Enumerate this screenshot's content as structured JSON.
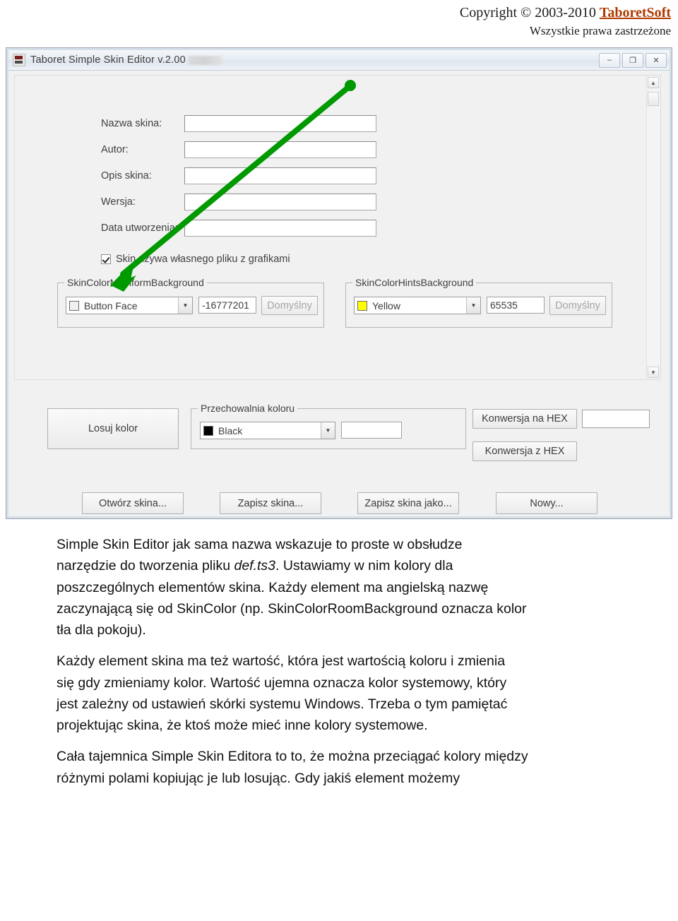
{
  "header": {
    "copyright_prefix": "Copyright © 2003-2010 ",
    "brand": "TaboretSoft",
    "rights": "Wszystkie prawa zastrzeżone"
  },
  "window": {
    "title": "Taboret Simple Skin Editor v.2.00",
    "buttons": {
      "minimize": "–",
      "maximize": "❐",
      "close": "✕"
    },
    "scrollbar": {
      "up": "▲",
      "down": "▼"
    },
    "fields": [
      {
        "label": "Nazwa skina:",
        "value": ""
      },
      {
        "label": "Autor:",
        "value": ""
      },
      {
        "label": "Opis skina:",
        "value": ""
      },
      {
        "label": "Wersja:",
        "value": ""
      },
      {
        "label": "Data utworzenia:",
        "value": ""
      }
    ],
    "checkbox": {
      "label": "Skin używa własnego pliku z grafikami",
      "checked": true
    },
    "group_mainform": {
      "title": "SkinColorMainformBackground",
      "combo_text": "Button Face",
      "combo_swatch": "#f0f0f0",
      "value": "-16777201",
      "default_button": "Domyślny",
      "arrow": "▼"
    },
    "group_hints": {
      "title": "SkinColorHintsBackground",
      "combo_text": "Yellow",
      "combo_swatch": "#ffff00",
      "value": "65535",
      "default_button": "Domyślny",
      "arrow": "▼"
    },
    "random_color_button": "Losuj kolor",
    "group_storage": {
      "title": "Przechowalnia koloru",
      "combo_text": "Black",
      "combo_swatch": "#000000",
      "value": "",
      "arrow": "▼"
    },
    "hex_buttons": {
      "to_hex": "Konwersja na HEX",
      "from_hex": "Konwersja z HEX",
      "hex_value": ""
    },
    "bottom_buttons": [
      "Otwórz skina...",
      "Zapisz skina...",
      "Zapisz skina jako...",
      "Nowy..."
    ]
  },
  "body_text": {
    "p1_a": "Simple Skin Editor jak sama nazwa wskazuje to proste w obsłudze",
    "p1_b_pre": "narzędzie do tworzenia pliku ",
    "p1_b_ital": "def.ts3",
    "p1_b_post": ". Ustawiamy w nim kolory dla",
    "p1_c": "poszczególnych elementów skina. Każdy element ma angielską nazwę",
    "p1_d": "zaczynającą się od SkinColor (np. SkinColorRoomBackground oznacza kolor",
    "p1_e": "tła dla pokoju).",
    "p2_a": "Każdy element skina ma też wartość, która jest wartością koloru i zmienia",
    "p2_b": "się gdy zmieniamy kolor. Wartość ujemna oznacza kolor systemowy, który",
    "p2_c": "jest zależny od ustawień skórki systemu Windows. Trzeba o tym pamiętać",
    "p2_d": "projektując skina, że ktoś może mieć inne kolory systemowe.",
    "p3_a": "Cała tajemnica Simple Skin Editora to to, że można przeciągać kolory między",
    "p3_b": "różnymi polami kopiując je lub losując. Gdy jakiś element możemy"
  }
}
